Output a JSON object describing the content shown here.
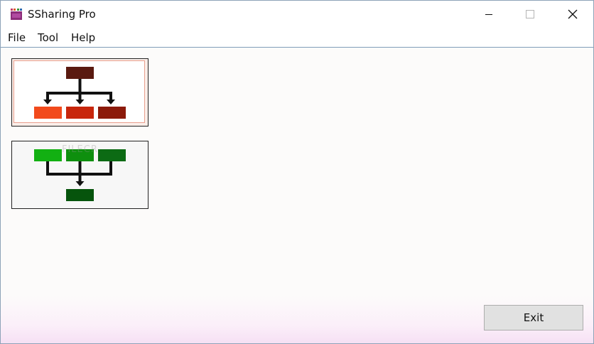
{
  "window": {
    "title": "SSharing Pro"
  },
  "menu": {
    "items": [
      {
        "label": "File"
      },
      {
        "label": "Tool"
      },
      {
        "label": "Help"
      }
    ]
  },
  "tiles": [
    {
      "name": "split-share",
      "colors": [
        "#5a1a10",
        "#f24a1c",
        "#c8260c",
        "#8c1a0a"
      ]
    },
    {
      "name": "merge-share",
      "colors": [
        "#12b012",
        "#0e8f0e",
        "#0c6b14",
        "#06540c"
      ]
    }
  ],
  "watermark": "FILECR",
  "footer": {
    "exit_label": "Exit"
  },
  "icons": {
    "app": "app-icon",
    "minimize": "minimize-icon",
    "maximize": "maximize-icon",
    "close": "close-icon"
  }
}
